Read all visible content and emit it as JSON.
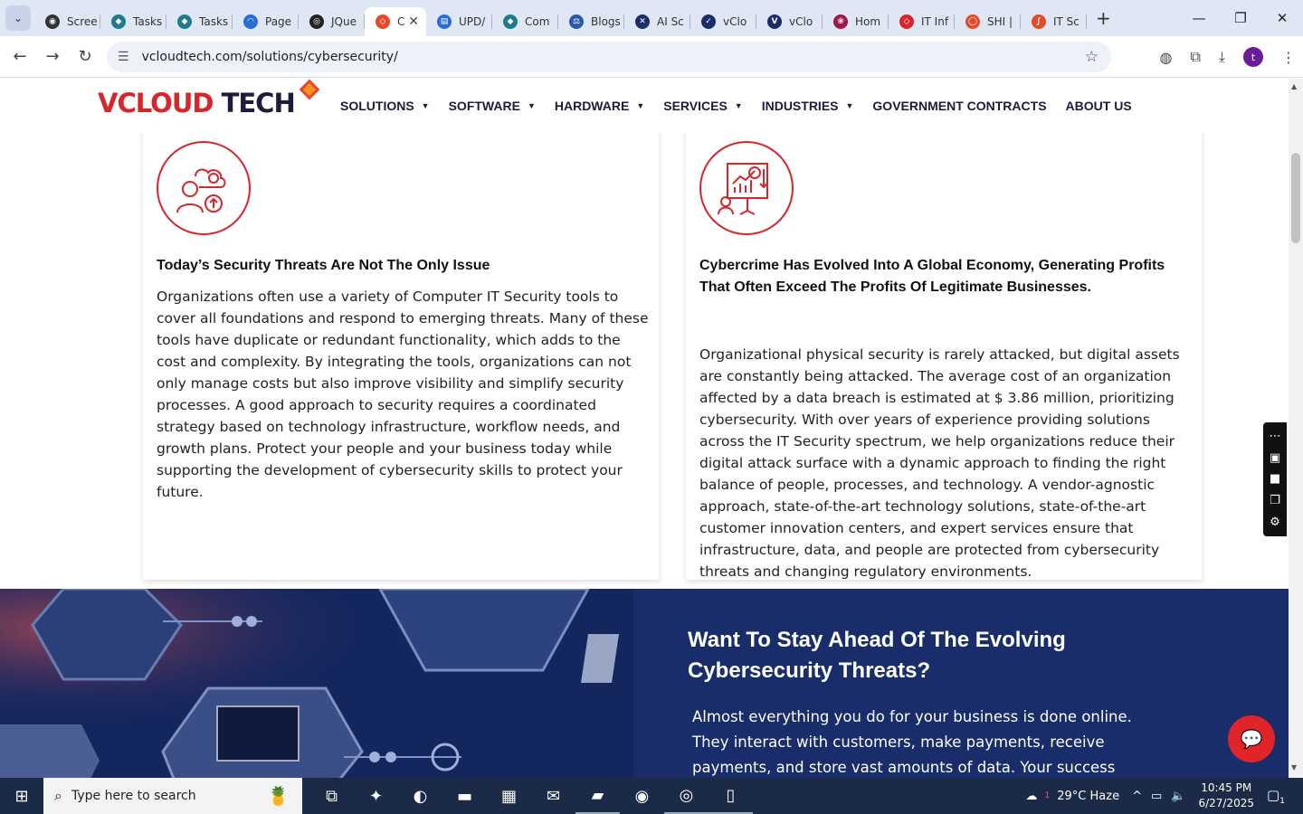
{
  "browser": {
    "tabs": [
      {
        "label": "Scree",
        "color": "#333333",
        "glyph": "◉"
      },
      {
        "label": "Tasks",
        "color": "#1f7a8c",
        "glyph": "◆"
      },
      {
        "label": "Tasks",
        "color": "#1f7a8c",
        "glyph": "◆"
      },
      {
        "label": "Page",
        "color": "#2a6bd6",
        "glyph": "◠"
      },
      {
        "label": "JQue",
        "color": "#222222",
        "glyph": "◎"
      },
      {
        "label": "C",
        "color": "#e34a2a",
        "glyph": "◇",
        "active": true
      },
      {
        "label": "UPD/",
        "color": "#2a6bd6",
        "glyph": "▤"
      },
      {
        "label": "Com",
        "color": "#1f7a8c",
        "glyph": "◆"
      },
      {
        "label": "Blogs",
        "color": "#2a5aa8",
        "glyph": "⚖"
      },
      {
        "label": "AI Sc",
        "color": "#1a2d6b",
        "glyph": "✕"
      },
      {
        "label": "vClo",
        "color": "#1a2d6b",
        "glyph": "✓"
      },
      {
        "label": "vClo",
        "color": "#1a2d6b",
        "glyph": "V"
      },
      {
        "label": "Hom",
        "color": "#a0184a",
        "glyph": "❀"
      },
      {
        "label": "IT Inf",
        "color": "#d6262c",
        "glyph": "◇"
      },
      {
        "label": "SHI |",
        "color": "#e34a2a",
        "glyph": "◯"
      },
      {
        "label": "IT Sc",
        "color": "#e34a2a",
        "glyph": "∫"
      }
    ],
    "url": "vcloudtech.com/solutions/cybersecurity/"
  },
  "site": {
    "logo_v": "V",
    "logo_cloud": "CLOUD",
    "logo_tech": " TECH",
    "nav": [
      {
        "label": "SOLUTIONS",
        "dropdown": true
      },
      {
        "label": "SOFTWARE",
        "dropdown": true
      },
      {
        "label": "HARDWARE",
        "dropdown": true
      },
      {
        "label": "SERVICES",
        "dropdown": true
      },
      {
        "label": "INDUSTRIES",
        "dropdown": true
      },
      {
        "label": "GOVERNMENT CONTRACTS",
        "dropdown": false
      },
      {
        "label": "ABOUT US",
        "dropdown": false
      }
    ]
  },
  "cards": [
    {
      "title": "Today’s Security Threats Are Not The Only Issue",
      "body": "Organizations often use a variety of Computer IT Security tools to cover all foundations and respond to emerging threats. Many of these tools have duplicate or redundant functionality, which adds to the cost and complexity. By integrating the tools, organizations can not only manage costs but also improve visibility and simplify security processes. A good approach to security requires a coordinated strategy based on technology infrastructure, workflow needs, and growth plans. Protect your people and your business today while supporting the development of cybersecurity skills to protect your future."
    },
    {
      "title": "Cybercrime Has Evolved Into A Global Economy, Generating Profits That Often Exceed The Profits Of Legitimate Businesses.",
      "body": "Organizational physical security is rarely attacked, but digital assets are constantly being attacked. The average cost of an organization affected by a data breach is estimated at $ 3.86 million, prioritizing cybersecurity. With over years of experience providing solutions across the IT Security spectrum, we help organizations reduce their digital attack surface with a dynamic approach to finding the right balance of people, processes, and technology. A vendor-agnostic approach, state-of-the-art technology solutions, state-of-the-art customer innovation centers, and expert services ensure that infrastructure, data, and people are protected from cybersecurity threats and changing regulatory environments."
    }
  ],
  "cta": {
    "title": "Want To Stay Ahead Of The Evolving Cybersecurity Threats?",
    "body": "Almost everything you do for your business is done online. They interact with customers, make payments, receive payments, and store vast amounts of data. Your success"
  },
  "taskbar": {
    "search_placeholder": "Type here to search",
    "weather": "29°C  Haze",
    "weather_badge": "1",
    "time": "10:45 PM",
    "date": "6/27/2025",
    "notif_count": "1"
  },
  "colors": {
    "brand_red": "#d6262c",
    "brand_navy": "#1c1c3c",
    "cta_bg": "#1a2d6b"
  }
}
